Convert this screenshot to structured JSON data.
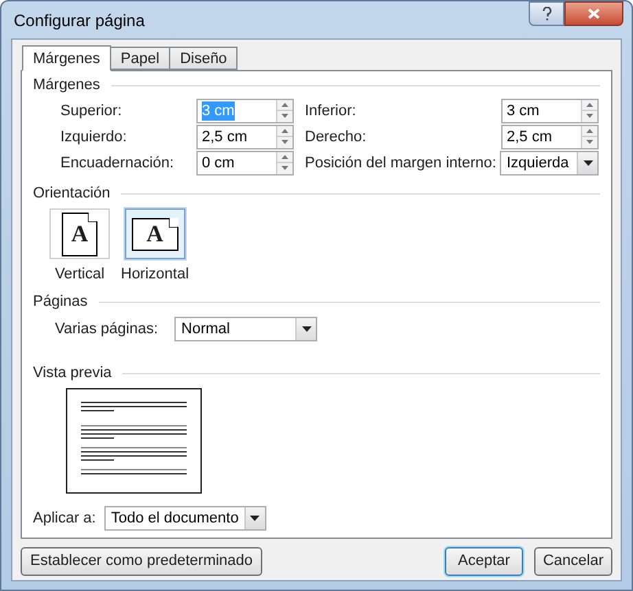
{
  "window": {
    "title": "Configurar página"
  },
  "tabs": [
    {
      "label": "Márgenes",
      "selected": true
    },
    {
      "label": "Papel",
      "selected": false
    },
    {
      "label": "Diseño",
      "selected": false
    }
  ],
  "margins": {
    "heading": "Márgenes",
    "fields": [
      {
        "label": "Superior:",
        "value": "3 cm",
        "kind": "spin",
        "selected": true
      },
      {
        "label": "Inferior:",
        "value": "3 cm",
        "kind": "spin",
        "selected": false
      },
      {
        "label": "Izquierdo:",
        "value": "2,5 cm",
        "kind": "spin",
        "selected": false
      },
      {
        "label": "Derecho:",
        "value": "2,5 cm",
        "kind": "spin",
        "selected": false
      },
      {
        "label": "Encuadernación:",
        "value": "0 cm",
        "kind": "spin",
        "selected": false
      },
      {
        "label": "Posición del margen interno:",
        "value": "Izquierda",
        "kind": "dropdown",
        "selected": false
      }
    ]
  },
  "orientation": {
    "heading": "Orientación",
    "options": [
      {
        "label": "Vertical",
        "glyph": "A",
        "kind": "portrait",
        "selected": false
      },
      {
        "label": "Horizontal",
        "glyph": "A",
        "kind": "landscape",
        "selected": true
      }
    ]
  },
  "pages": {
    "heading": "Páginas",
    "label": "Varias páginas:",
    "value": "Normal"
  },
  "preview": {
    "heading": "Vista previa"
  },
  "apply": {
    "label": "Aplicar a:",
    "value": "Todo el documento"
  },
  "buttons": [
    {
      "label": "Establecer como predeterminado",
      "default": false
    },
    {
      "label": "Aceptar",
      "default": true
    },
    {
      "label": "Cancelar",
      "default": false
    }
  ]
}
